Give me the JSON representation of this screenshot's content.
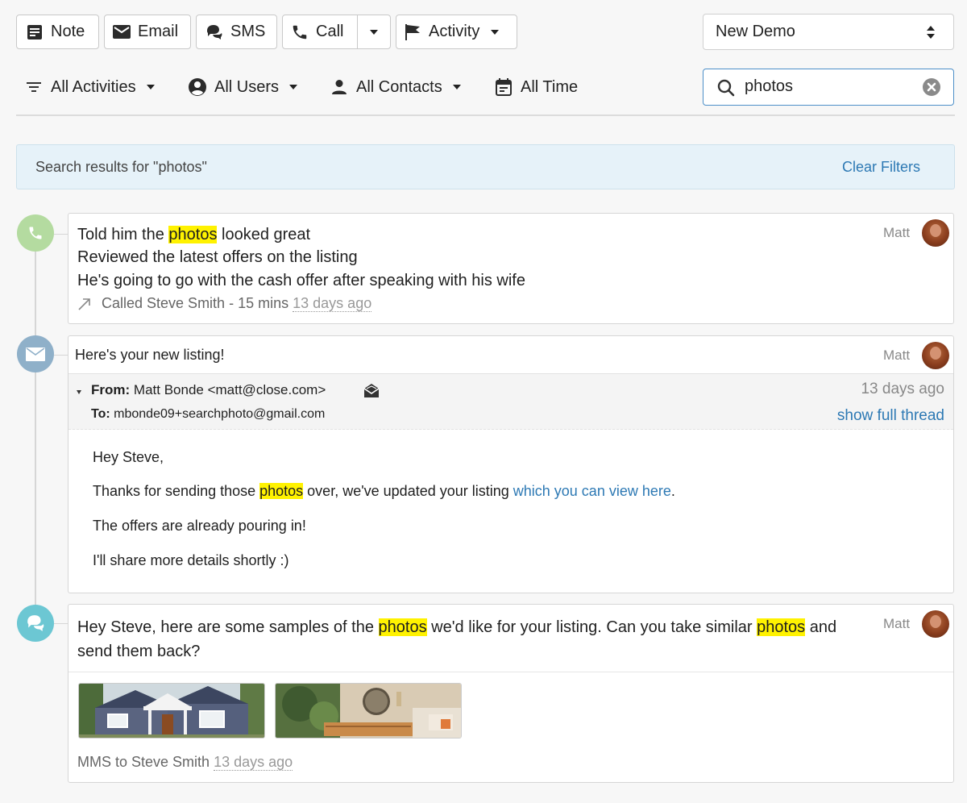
{
  "toolbar": {
    "note_label": "Note",
    "email_label": "Email",
    "sms_label": "SMS",
    "call_label": "Call",
    "activity_label": "Activity",
    "template_select_value": "New Demo"
  },
  "filters": {
    "activities_label": "All Activities",
    "users_label": "All Users",
    "contacts_label": "All Contacts",
    "time_label": "All Time",
    "search_value": "photos"
  },
  "banner": {
    "text": "Search results for \"photos\"",
    "clear_label": "Clear Filters"
  },
  "call": {
    "user": "Matt",
    "line1_pre": "Told him the ",
    "line1_hl": "photos",
    "line1_post": " looked great",
    "line2": "Reviewed the latest offers on the listing",
    "line3": "He's going to go with the cash offer after speaking with his wife",
    "meta_text": "Called Steve Smith",
    "duration": "- 15 mins",
    "time": "13 days ago"
  },
  "email": {
    "subject": "Here's your new listing!",
    "user": "Matt",
    "from_label": "From:",
    "from_value": "Matt Bonde <matt@close.com>",
    "to_label": "To:",
    "to_value": "mbonde09+searchphoto@gmail.com",
    "time": "13 days ago",
    "thread_link": "show full thread",
    "greeting": "Hey Steve,",
    "p1_pre": "Thanks for sending those ",
    "p1_hl": "photos",
    "p1_mid": " over, we've updated your listing ",
    "p1_link": "which you can view here",
    "p1_post": ".",
    "p2": "The offers are already pouring in!",
    "p3": "I'll share more details shortly :)"
  },
  "sms": {
    "user": "Matt",
    "l1_pre": "Hey Steve, here are some samples of the ",
    "l1_hl1": "photos",
    "l1_mid": " we'd like for your listing. Can you take similar ",
    "l1_hl2": "photos",
    "l1_post": " and",
    "l2": "send them back?",
    "meta_text": "MMS to Steve Smith",
    "time": "13 days ago"
  },
  "colors": {
    "call_circle": "#b4dba0",
    "email_circle": "#8fb0c9",
    "sms_circle": "#6cc7d3",
    "highlight": "#fff200",
    "link": "#2d79b4"
  }
}
